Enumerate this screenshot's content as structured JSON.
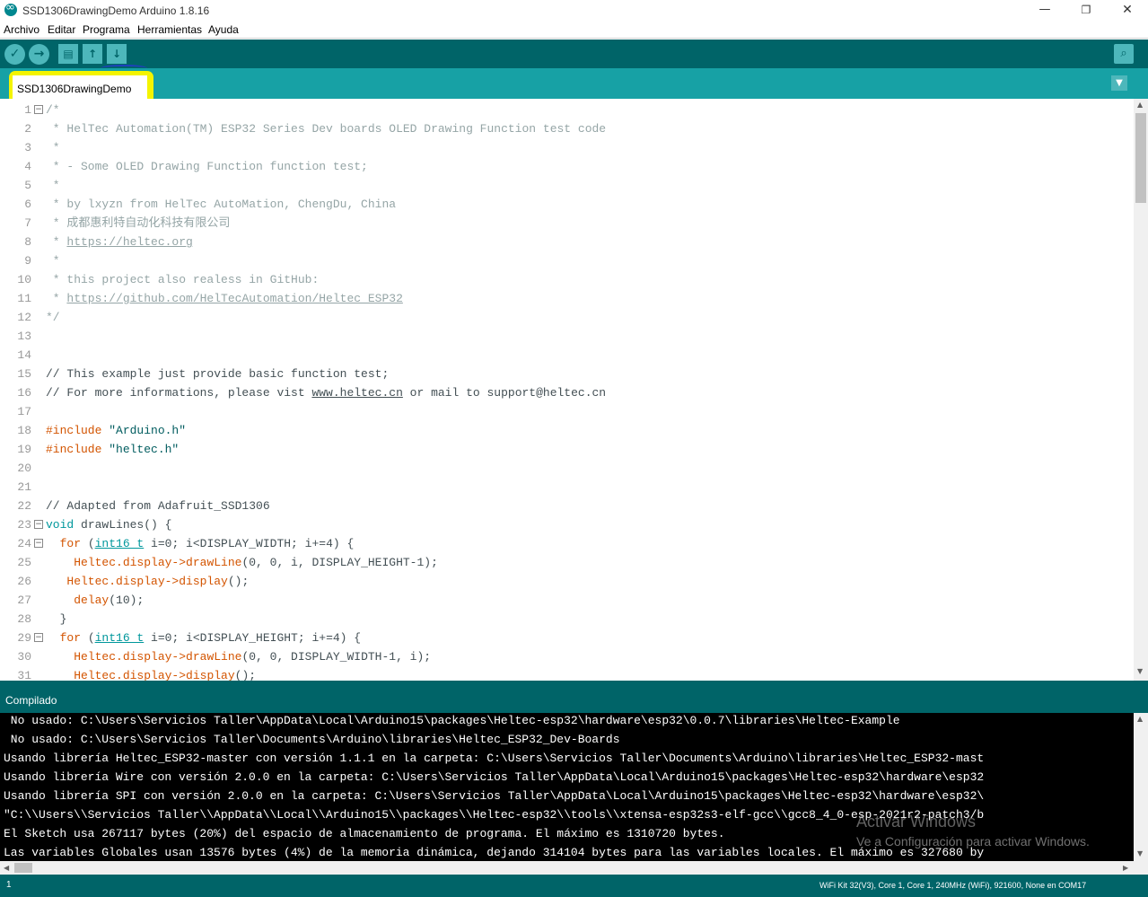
{
  "window": {
    "title": "SSD1306DrawingDemo Arduino 1.8.16",
    "minimize_glyph": "—",
    "restore_glyph": "❐",
    "close_glyph": "✕"
  },
  "menu": [
    "Archivo",
    "Editar",
    "Programa",
    "Herramientas",
    "Ayuda"
  ],
  "toolbar": {
    "verify_icon": "✓",
    "upload_icon": "→",
    "new_icon": "▤",
    "open_icon": "↑",
    "save_icon": "↓",
    "serial_icon": "⌕"
  },
  "tab": {
    "label": "SSD1306DrawingDemo",
    "menu_icon": "▼"
  },
  "editor": {
    "lines": [
      {
        "n": "1",
        "fold": "−",
        "segs": [
          {
            "t": "/*",
            "c": "cmt"
          }
        ]
      },
      {
        "n": "2",
        "segs": [
          {
            "t": " * HelTec Automation(TM) ESP32 Series Dev boards OLED Drawing Function test code",
            "c": "cmt"
          }
        ]
      },
      {
        "n": "3",
        "segs": [
          {
            "t": " *",
            "c": "cmt"
          }
        ]
      },
      {
        "n": "4",
        "segs": [
          {
            "t": " * - Some OLED Drawing Function function test;",
            "c": "cmt"
          }
        ]
      },
      {
        "n": "5",
        "segs": [
          {
            "t": " *",
            "c": "cmt"
          }
        ]
      },
      {
        "n": "6",
        "segs": [
          {
            "t": " * by lxyzn from HelTec AutoMation, ChengDu, China",
            "c": "cmt"
          }
        ]
      },
      {
        "n": "7",
        "segs": [
          {
            "t": " * 成都惠利特自动化科技有限公司",
            "c": "cmt"
          }
        ]
      },
      {
        "n": "8",
        "segs": [
          {
            "t": " * ",
            "c": "cmt"
          },
          {
            "t": "https://heltec.org",
            "c": "cmt lnk"
          }
        ]
      },
      {
        "n": "9",
        "segs": [
          {
            "t": " *",
            "c": "cmt"
          }
        ]
      },
      {
        "n": "10",
        "segs": [
          {
            "t": " * this project also realess in GitHub:",
            "c": "cmt"
          }
        ]
      },
      {
        "n": "11",
        "segs": [
          {
            "t": " * ",
            "c": "cmt"
          },
          {
            "t": "https://github.com/HelTecAutomation/Heltec_ESP32",
            "c": "cmt lnk"
          }
        ]
      },
      {
        "n": "12",
        "segs": [
          {
            "t": "*/",
            "c": "cmt"
          }
        ]
      },
      {
        "n": "13",
        "segs": []
      },
      {
        "n": "14",
        "segs": []
      },
      {
        "n": "15",
        "segs": [
          {
            "t": "// This example just provide basic function test;",
            "c": ""
          }
        ]
      },
      {
        "n": "16",
        "segs": [
          {
            "t": "// For more informations, please vist ",
            "c": ""
          },
          {
            "t": "www.heltec.cn",
            "c": "lnk"
          },
          {
            "t": " or mail to support@heltec.cn",
            "c": ""
          }
        ]
      },
      {
        "n": "17",
        "segs": []
      },
      {
        "n": "18",
        "segs": [
          {
            "t": "#include ",
            "c": "fn"
          },
          {
            "t": "\"Arduino.h\"",
            "c": "str"
          }
        ]
      },
      {
        "n": "19",
        "segs": [
          {
            "t": "#include ",
            "c": "fn"
          },
          {
            "t": "\"heltec.h\"",
            "c": "str"
          }
        ]
      },
      {
        "n": "20",
        "segs": []
      },
      {
        "n": "21",
        "segs": []
      },
      {
        "n": "22",
        "segs": [
          {
            "t": "// Adapted from Adafruit_SSD1306",
            "c": ""
          }
        ]
      },
      {
        "n": "23",
        "fold": "−",
        "segs": [
          {
            "t": "void",
            "c": "kw"
          },
          {
            "t": " drawLines() {",
            "c": ""
          }
        ]
      },
      {
        "n": "24",
        "fold": "−",
        "segs": [
          {
            "t": "  ",
            "c": ""
          },
          {
            "t": "for",
            "c": "fn"
          },
          {
            "t": " (",
            "c": ""
          },
          {
            "t": "int16_t",
            "c": "kw lnk"
          },
          {
            "t": " i=0; i<DISPLAY_WIDTH; i+=4) {",
            "c": ""
          }
        ]
      },
      {
        "n": "25",
        "segs": [
          {
            "t": "    ",
            "c": ""
          },
          {
            "t": "Heltec.display->drawLine",
            "c": "fn"
          },
          {
            "t": "(0, 0, i, DISPLAY_HEIGHT-1);",
            "c": ""
          }
        ]
      },
      {
        "n": "26",
        "segs": [
          {
            "t": "   ",
            "c": ""
          },
          {
            "t": "Heltec.display->display",
            "c": "fn"
          },
          {
            "t": "();",
            "c": ""
          }
        ]
      },
      {
        "n": "27",
        "segs": [
          {
            "t": "    ",
            "c": ""
          },
          {
            "t": "delay",
            "c": "fn"
          },
          {
            "t": "(10);",
            "c": ""
          }
        ]
      },
      {
        "n": "28",
        "segs": [
          {
            "t": "  }",
            "c": ""
          }
        ]
      },
      {
        "n": "29",
        "fold": "−",
        "segs": [
          {
            "t": "  ",
            "c": ""
          },
          {
            "t": "for",
            "c": "fn"
          },
          {
            "t": " (",
            "c": ""
          },
          {
            "t": "int16_t",
            "c": "kw lnk"
          },
          {
            "t": " i=0; i<DISPLAY_HEIGHT; i+=4) {",
            "c": ""
          }
        ]
      },
      {
        "n": "30",
        "segs": [
          {
            "t": "    ",
            "c": ""
          },
          {
            "t": "Heltec.display->drawLine",
            "c": "fn"
          },
          {
            "t": "(0, 0, DISPLAY_WIDTH-1, i);",
            "c": ""
          }
        ]
      },
      {
        "n": "31",
        "segs": [
          {
            "t": "    ",
            "c": ""
          },
          {
            "t": "Heltec.display->display",
            "c": "fn"
          },
          {
            "t": "();",
            "c": ""
          }
        ]
      }
    ]
  },
  "console": {
    "status": "Compilado",
    "lines": [
      " No usado: C:\\Users\\Servicios Taller\\AppData\\Local\\Arduino15\\packages\\Heltec-esp32\\hardware\\esp32\\0.0.7\\libraries\\Heltec-Example",
      " No usado: C:\\Users\\Servicios Taller\\Documents\\Arduino\\libraries\\Heltec_ESP32_Dev-Boards",
      "Usando librería Heltec_ESP32-master con versión 1.1.1 en la carpeta: C:\\Users\\Servicios Taller\\Documents\\Arduino\\libraries\\Heltec_ESP32-mast",
      "Usando librería Wire con versión 2.0.0 en la carpeta: C:\\Users\\Servicios Taller\\AppData\\Local\\Arduino15\\packages\\Heltec-esp32\\hardware\\esp32",
      "Usando librería SPI con versión 2.0.0 en la carpeta: C:\\Users\\Servicios Taller\\AppData\\Local\\Arduino15\\packages\\Heltec-esp32\\hardware\\esp32\\",
      "\"C:\\\\Users\\\\Servicios Taller\\\\AppData\\\\Local\\\\Arduino15\\\\packages\\\\Heltec-esp32\\\\tools\\\\xtensa-esp32s3-elf-gcc\\\\gcc8_4_0-esp-2021r2-patch3/b",
      "El Sketch usa 267117 bytes (20%) del espacio de almacenamiento de programa. El máximo es 1310720 bytes.",
      "Las variables Globales usan 13576 bytes (4%) de la memoria dinámica, dejando 314104 bytes para las variables locales. El máximo es 327680 by"
    ]
  },
  "watermark": {
    "line1": "Activar Windows",
    "line2": "Ve a Configuración para activar Windows."
  },
  "footer": {
    "line": "1",
    "board": "WiFi Kit 32(V3), Core 1, Core 1, 240MHz (WiFi), 921600, None en COM17"
  }
}
